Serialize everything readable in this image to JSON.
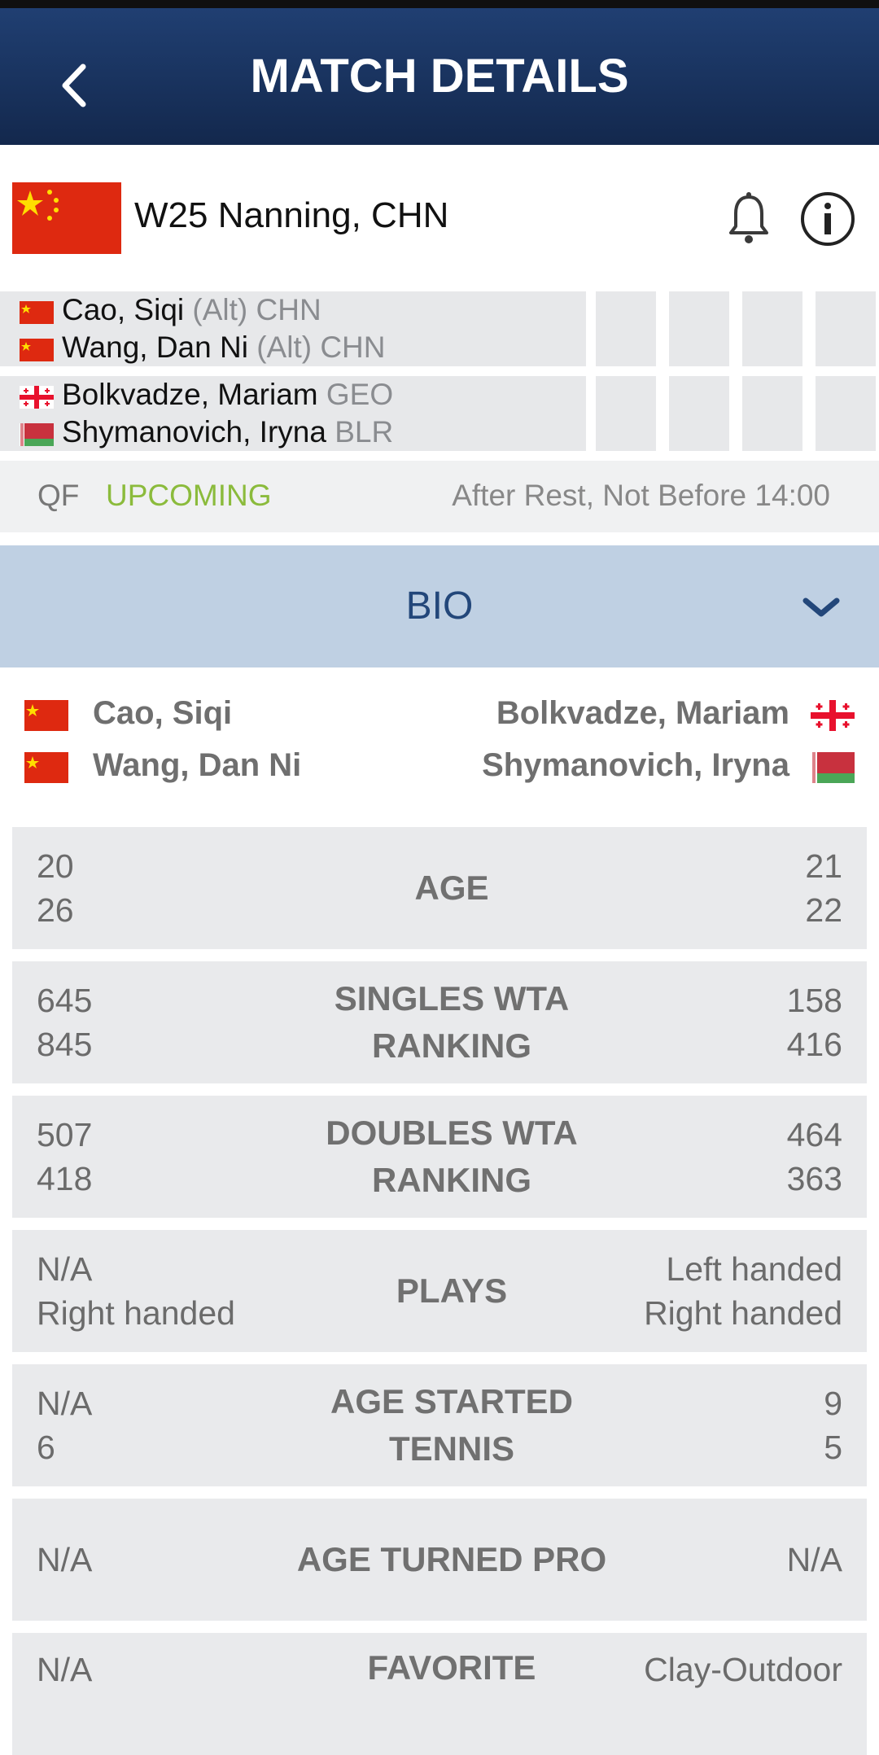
{
  "header": {
    "title": "MATCH DETAILS",
    "back_icon": "chevron-left-icon"
  },
  "tournament": {
    "name": "W25 Nanning, CHN",
    "flag": "china-flag-icon"
  },
  "scoreboard": {
    "team1": [
      {
        "name": "Cao, Siqi",
        "tag": "(Alt)",
        "country": "CHN"
      },
      {
        "name": "Wang, Dan Ni",
        "tag": "(Alt)",
        "country": "CHN"
      }
    ],
    "team2": [
      {
        "name": "Bolkvadze, Mariam",
        "country": "GEO"
      },
      {
        "name": "Shymanovich, Iryna",
        "country": "BLR"
      }
    ]
  },
  "status": {
    "round": "QF",
    "state": "UPCOMING",
    "schedule": "After Rest, Not Before 14:00"
  },
  "bio": {
    "title": "BIO"
  },
  "bio_players": {
    "left": [
      "Cao, Siqi",
      "Wang, Dan Ni"
    ],
    "right": [
      "Bolkvadze, Mariam",
      "Shymanovich, Iryna"
    ]
  },
  "stats": [
    {
      "label": "AGE",
      "left": [
        "20",
        "26"
      ],
      "right": [
        "21",
        "22"
      ]
    },
    {
      "label": "SINGLES WTA RANKING",
      "left": [
        "645",
        "845"
      ],
      "right": [
        "158",
        "416"
      ]
    },
    {
      "label": "DOUBLES WTA RANKING",
      "left": [
        "507",
        "418"
      ],
      "right": [
        "464",
        "363"
      ]
    },
    {
      "label": "PLAYS",
      "left": [
        "N/A",
        "Right handed"
      ],
      "right": [
        "Left handed",
        "Right handed"
      ]
    },
    {
      "label": "AGE STARTED TENNIS",
      "left": [
        "N/A",
        "6"
      ],
      "right": [
        "9",
        "5"
      ]
    },
    {
      "label": "AGE TURNED PRO",
      "left": [
        "N/A"
      ],
      "right": [
        "N/A"
      ]
    },
    {
      "label": "FAVORITE",
      "left": [
        "N/A"
      ],
      "right": [
        "Clay-Outdoor"
      ]
    }
  ],
  "colors": {
    "header": "#1a3560",
    "bio_bar": "#bfd0e3",
    "upcoming": "#8bbb3c",
    "stat_bg": "#e9eaec"
  }
}
